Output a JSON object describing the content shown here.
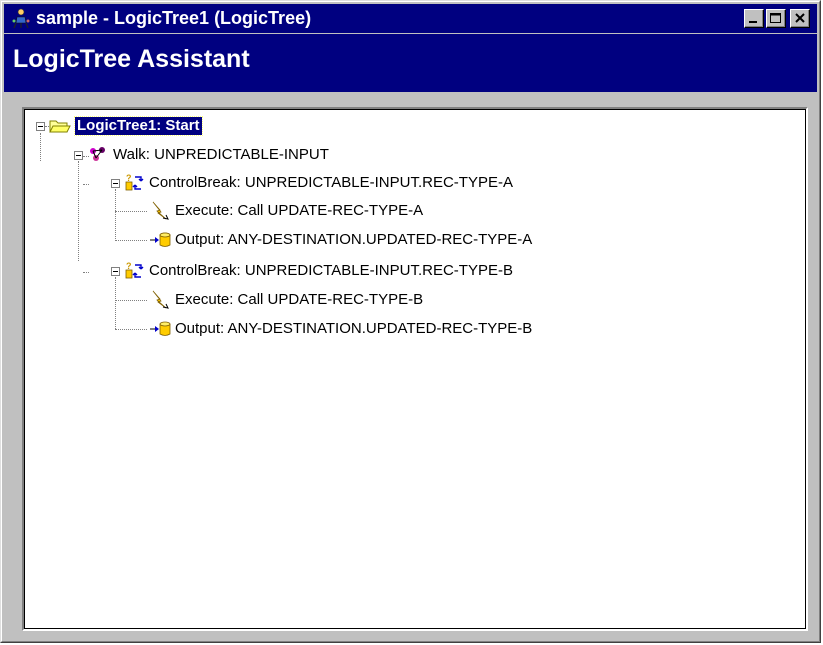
{
  "window": {
    "title": "sample - LogicTree1 (LogicTree)",
    "buttons": [
      "minimize",
      "maximize",
      "close"
    ]
  },
  "assistant": {
    "title": "LogicTree Assistant"
  },
  "tree": {
    "nodes": [
      {
        "label": "LogicTree1: Start",
        "icon": "folder-open-icon",
        "selected": true,
        "expanded": true
      },
      {
        "label": "Walk: UNPREDICTABLE-INPUT",
        "icon": "walk-icon",
        "expanded": true
      },
      {
        "label": "ControlBreak: UNPREDICTABLE-INPUT.REC-TYPE-A",
        "icon": "controlbreak-icon",
        "expanded": true
      },
      {
        "label": "Execute: Call UPDATE-REC-TYPE-A",
        "icon": "lightning-icon"
      },
      {
        "label": "Output: ANY-DESTINATION.UPDATED-REC-TYPE-A",
        "icon": "output-database-icon"
      },
      {
        "label": "ControlBreak: UNPREDICTABLE-INPUT.REC-TYPE-B",
        "icon": "controlbreak-icon",
        "expanded": true
      },
      {
        "label": "Execute: Call UPDATE-REC-TYPE-B",
        "icon": "lightning-icon"
      },
      {
        "label": "Output: ANY-DESTINATION.UPDATED-REC-TYPE-B",
        "icon": "output-database-icon"
      }
    ]
  },
  "colors": {
    "titlebar": "#000080",
    "selection": "#000080",
    "face": "#c0c0c0"
  }
}
